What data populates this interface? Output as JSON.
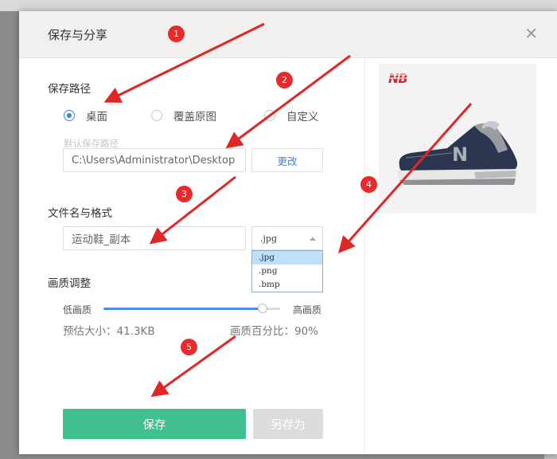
{
  "dialog": {
    "title": "保存与分享",
    "close_icon": "close-icon"
  },
  "save_path": {
    "heading": "保存路径",
    "options": [
      {
        "label": "桌面",
        "checked": true
      },
      {
        "label": "覆盖原图",
        "checked": false
      },
      {
        "label": "自定义",
        "checked": false
      }
    ],
    "default_hint": "默认保存路径",
    "path_value": "C:\\Users\\Administrator\\Desktop",
    "change_label": "更改"
  },
  "file": {
    "heading": "文件名与格式",
    "name_value": "运动鞋_副本",
    "format_selected": ".jpg",
    "format_options": [
      ".jpg",
      ".png",
      ".bmp"
    ]
  },
  "quality": {
    "heading": "画质调整",
    "low_label": "低画质",
    "high_label": "高画质",
    "level_percent": 90,
    "size_text": "预估大小：41.3KB",
    "percent_text": "画质百分比：90%"
  },
  "actions": {
    "save_label": "保存",
    "save_as_label": "另存为"
  },
  "preview": {
    "image": "sneaker-photo",
    "logo": "new-balance-logo"
  },
  "annotations": [
    "1",
    "2",
    "3",
    "4",
    "5"
  ],
  "colors": {
    "accent_blue": "#3a84e8",
    "save_green": "#3fc08e",
    "annotation_red": "#ea2a2a"
  }
}
